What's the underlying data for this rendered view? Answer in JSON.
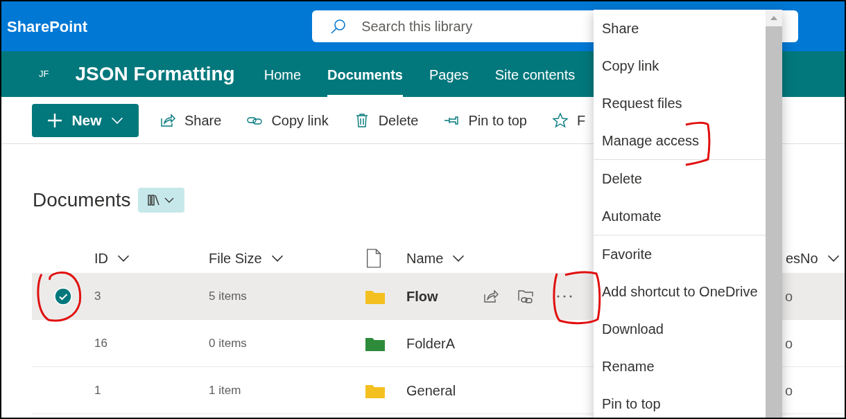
{
  "suite_bar": {
    "app_name": "SharePoint",
    "search": {
      "placeholder": "Search this library"
    }
  },
  "site_header": {
    "initials": "JF",
    "title": "JSON Formatting",
    "nav": [
      {
        "label": "Home",
        "selected": false
      },
      {
        "label": "Documents",
        "selected": true
      },
      {
        "label": "Pages",
        "selected": false
      },
      {
        "label": "Site contents",
        "selected": false
      }
    ]
  },
  "command_bar": {
    "new_button": "New",
    "items": [
      {
        "kind": "share",
        "label": "Share"
      },
      {
        "kind": "link",
        "label": "Copy link"
      },
      {
        "kind": "delete",
        "label": "Delete"
      },
      {
        "kind": "pin",
        "label": "Pin to top"
      },
      {
        "kind": "star",
        "label": "F"
      }
    ]
  },
  "library": {
    "title": "Documents",
    "columns": {
      "id": "ID",
      "file_size": "File Size",
      "name": "Name",
      "column_6": "esNo"
    },
    "rows": [
      {
        "id": "3",
        "file_size": "5 items",
        "name": "Flow",
        "color": "#f4c020",
        "column_6": "o",
        "selected": true
      },
      {
        "id": "16",
        "file_size": "0 items",
        "name": "FolderA",
        "color": "#2e8b3a",
        "column_6": "o",
        "selected": false
      },
      {
        "id": "1",
        "file_size": "1 item",
        "name": "General",
        "color": "#f4c020",
        "column_6": "o",
        "selected": false
      }
    ]
  },
  "context_menu": {
    "groups": [
      [
        "Share",
        "Copy link",
        "Request files",
        "Manage access"
      ],
      [
        "Delete",
        "Automate"
      ],
      [
        "Favorite",
        "Add shortcut to OneDrive",
        "Download",
        "Rename",
        "Pin to top"
      ]
    ]
  }
}
